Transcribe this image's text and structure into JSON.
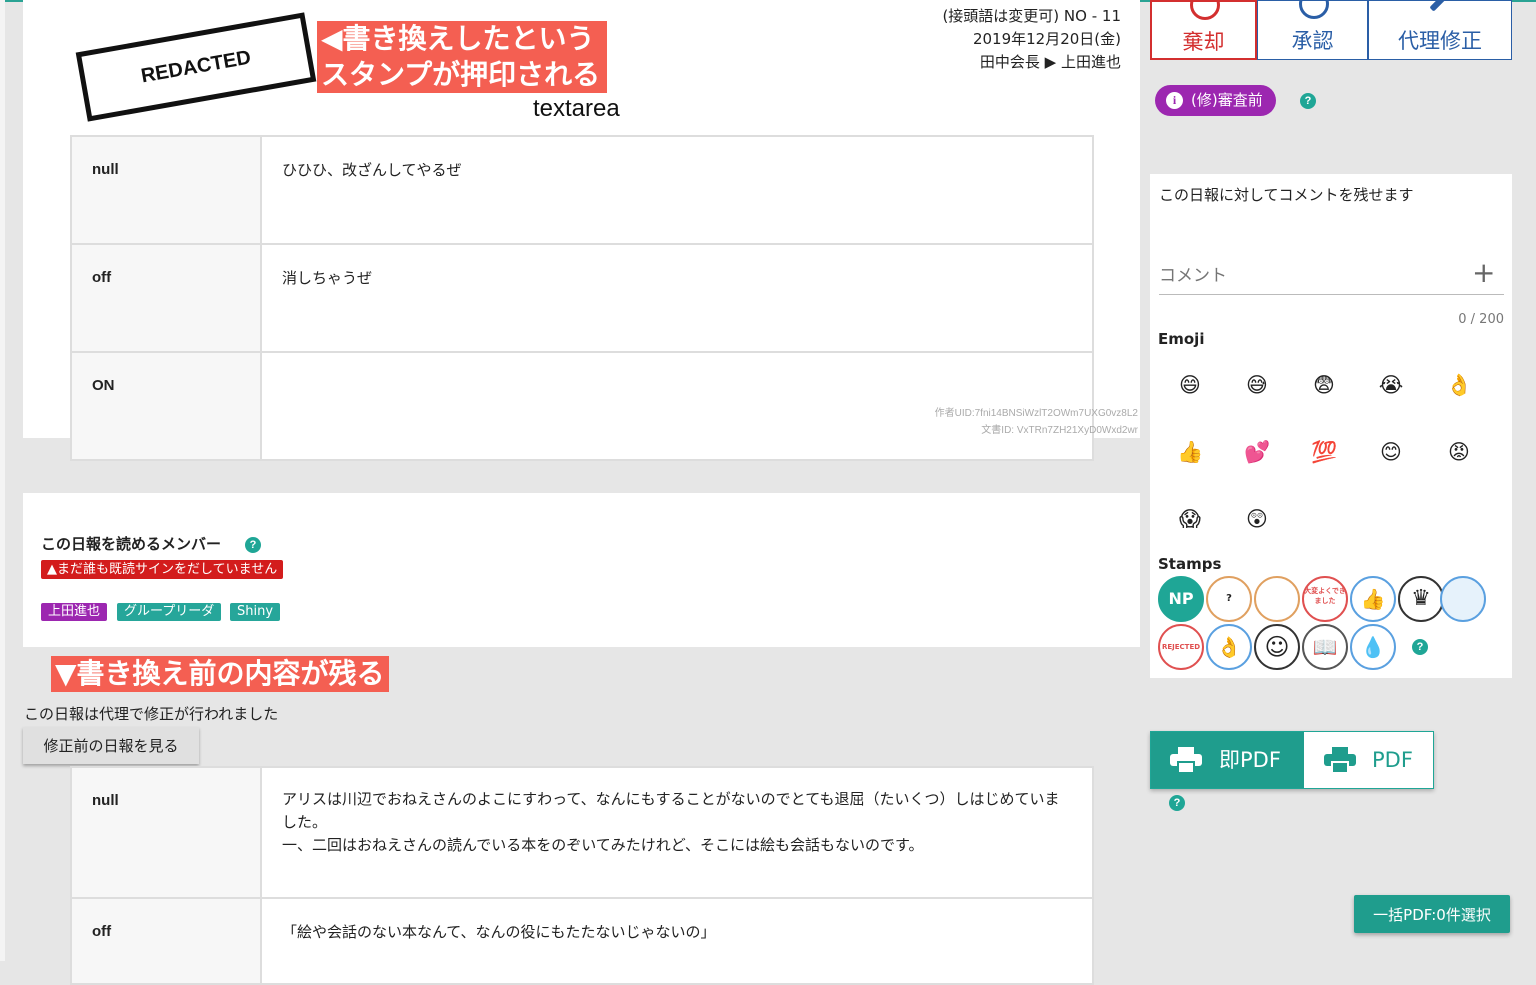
{
  "header": {
    "prefix_no": "(接頭語は変更可) NO - 11",
    "date": "2019年12月20日(金)",
    "route_from": "田中会長",
    "route_to": "上田進也"
  },
  "stamp_text": "REDACTED",
  "annotations": {
    "top_line1": "◀書き換えしたという",
    "top_line2": "スタンプが押印される",
    "bottom": "▼書き換え前の内容が残る"
  },
  "form_label": "textarea",
  "rows": [
    {
      "key": "null",
      "value": "ひひひ、改ざんしてやるぜ"
    },
    {
      "key": "off",
      "value": "消しちゃうぜ"
    },
    {
      "key": "ON",
      "value": ""
    }
  ],
  "author_uid": "作者UID:7fni14BNSiWzlT2OWm7UXG0vz8L2",
  "doc_id": "文書ID: VxTRn7ZH21XyD0Wxd2wr",
  "members": {
    "title": "この日報を読めるメンバー",
    "warning": "▲まだ誰も既読サインをだしていません",
    "tags": [
      {
        "label": "上田進也",
        "color": "#9c27b0"
      },
      {
        "label": "グループリーダ",
        "color": "#26a69a"
      },
      {
        "label": "Shiny",
        "color": "#26a69a"
      }
    ]
  },
  "proxy_note": "この日報は代理で修正が行われました",
  "view_before_button": "修正前の日報を見る",
  "previous_rows": [
    {
      "key": "null",
      "line1": "アリスは川辺でおねえさんのよこにすわって、なんにもすることがないのでとても退屈（たいくつ）しはじめていました。",
      "line2": "一、二回はおねえさんの読んでいる本をのぞいてみたけれど、そこには絵も会話もないのです。"
    },
    {
      "key": "off",
      "line1": "「絵や会話のない本なんて、なんの役にもたたないじゃないの」",
      "line2": ""
    }
  ],
  "actions": {
    "reject": "棄却",
    "approve": "承認",
    "proxy_edit": "代理修正"
  },
  "status_badge": "(修)審査前",
  "help_glyph": "?",
  "comment": {
    "description": "この日報に対してコメントを残せます",
    "placeholder": "コメント",
    "plus": "+",
    "counter": "0 / 200",
    "emoji_title": "Emoji",
    "emojis": [
      "😄",
      "😅",
      "😨",
      "😭",
      "👌",
      "👍",
      "💕",
      "💯",
      "😊",
      "😡",
      "😱",
      "😲"
    ],
    "stamps_title": "Stamps",
    "stamps": [
      {
        "name": "np-logo",
        "text": "NP"
      },
      {
        "name": "girl-question",
        "text": "?"
      },
      {
        "name": "girl-ok",
        "text": ""
      },
      {
        "name": "hanko-stamp",
        "text": "大変よくできました"
      },
      {
        "name": "thumbs-up",
        "text": "👍"
      },
      {
        "name": "crown",
        "text": "♛"
      },
      {
        "name": "running-man",
        "text": ""
      },
      {
        "name": "rejected-stamp",
        "text": "REJECTED"
      },
      {
        "name": "ok-hand",
        "text": "👌"
      },
      {
        "name": "smiley-face",
        "text": "☺"
      },
      {
        "name": "reading-person",
        "text": "📖"
      },
      {
        "name": "teardrop",
        "text": "💧"
      }
    ]
  },
  "pdf": {
    "instant": "即PDF",
    "plain": "PDF",
    "bulk": "一括PDF:0件選択"
  },
  "colors": {
    "accent_teal": "#1f9d8d",
    "reject_red": "#d32f2f",
    "approve_blue": "#2a5ea6",
    "status_purple": "#9c27b0",
    "annotation_red": "#f45f52"
  }
}
